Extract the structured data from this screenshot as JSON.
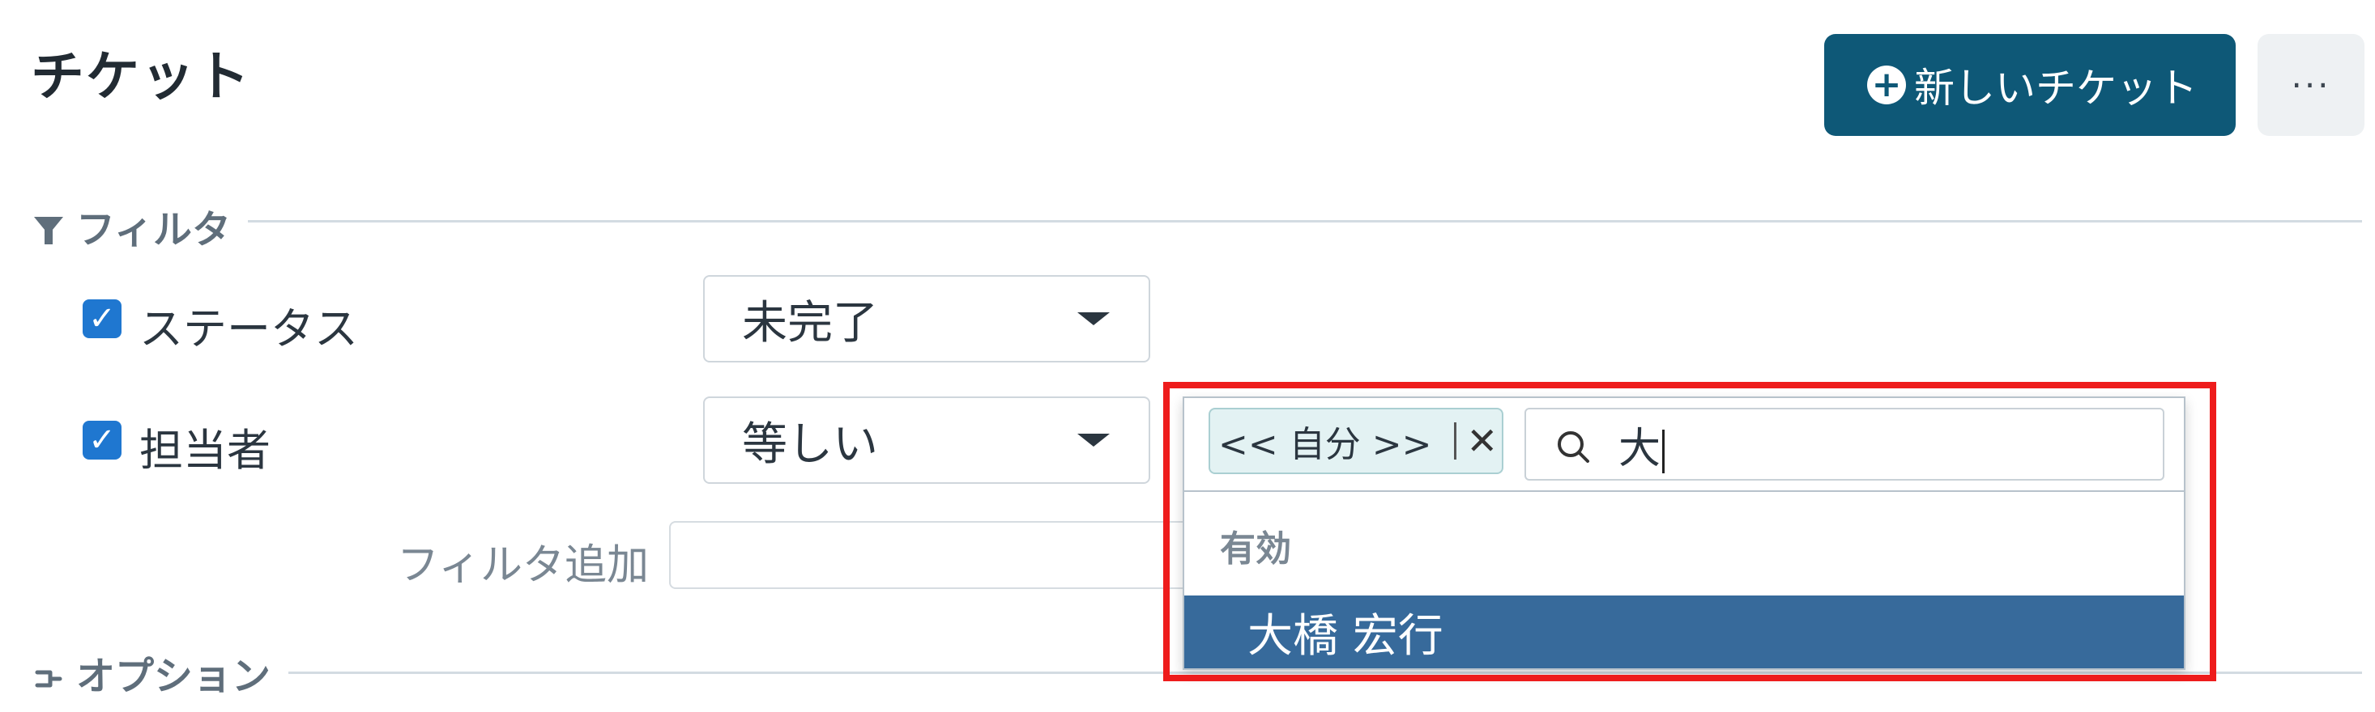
{
  "header": {
    "title": "チケット",
    "new_ticket_label": "新しいチケット",
    "more_label": "···"
  },
  "filters_section": {
    "title": "フィルタ",
    "rows": [
      {
        "label": "ステータス",
        "checked": true,
        "operator": "未完了"
      },
      {
        "label": "担当者",
        "checked": true,
        "operator": "等しい"
      }
    ],
    "add_filter_label": "フィルタ追加"
  },
  "assignee_dropdown": {
    "selected_tag": "<< 自分 >>",
    "search_value": "大",
    "group_label": "有効",
    "options": [
      "大橋 宏行"
    ],
    "highlighted_option": "大橋 宏行"
  },
  "options_section": {
    "title": "オプション"
  },
  "colors": {
    "primary_button": "#0e5877",
    "checkbox": "#1f77d0",
    "highlighted_option": "#376a9b",
    "annotation_box": "#ee1c1c"
  }
}
